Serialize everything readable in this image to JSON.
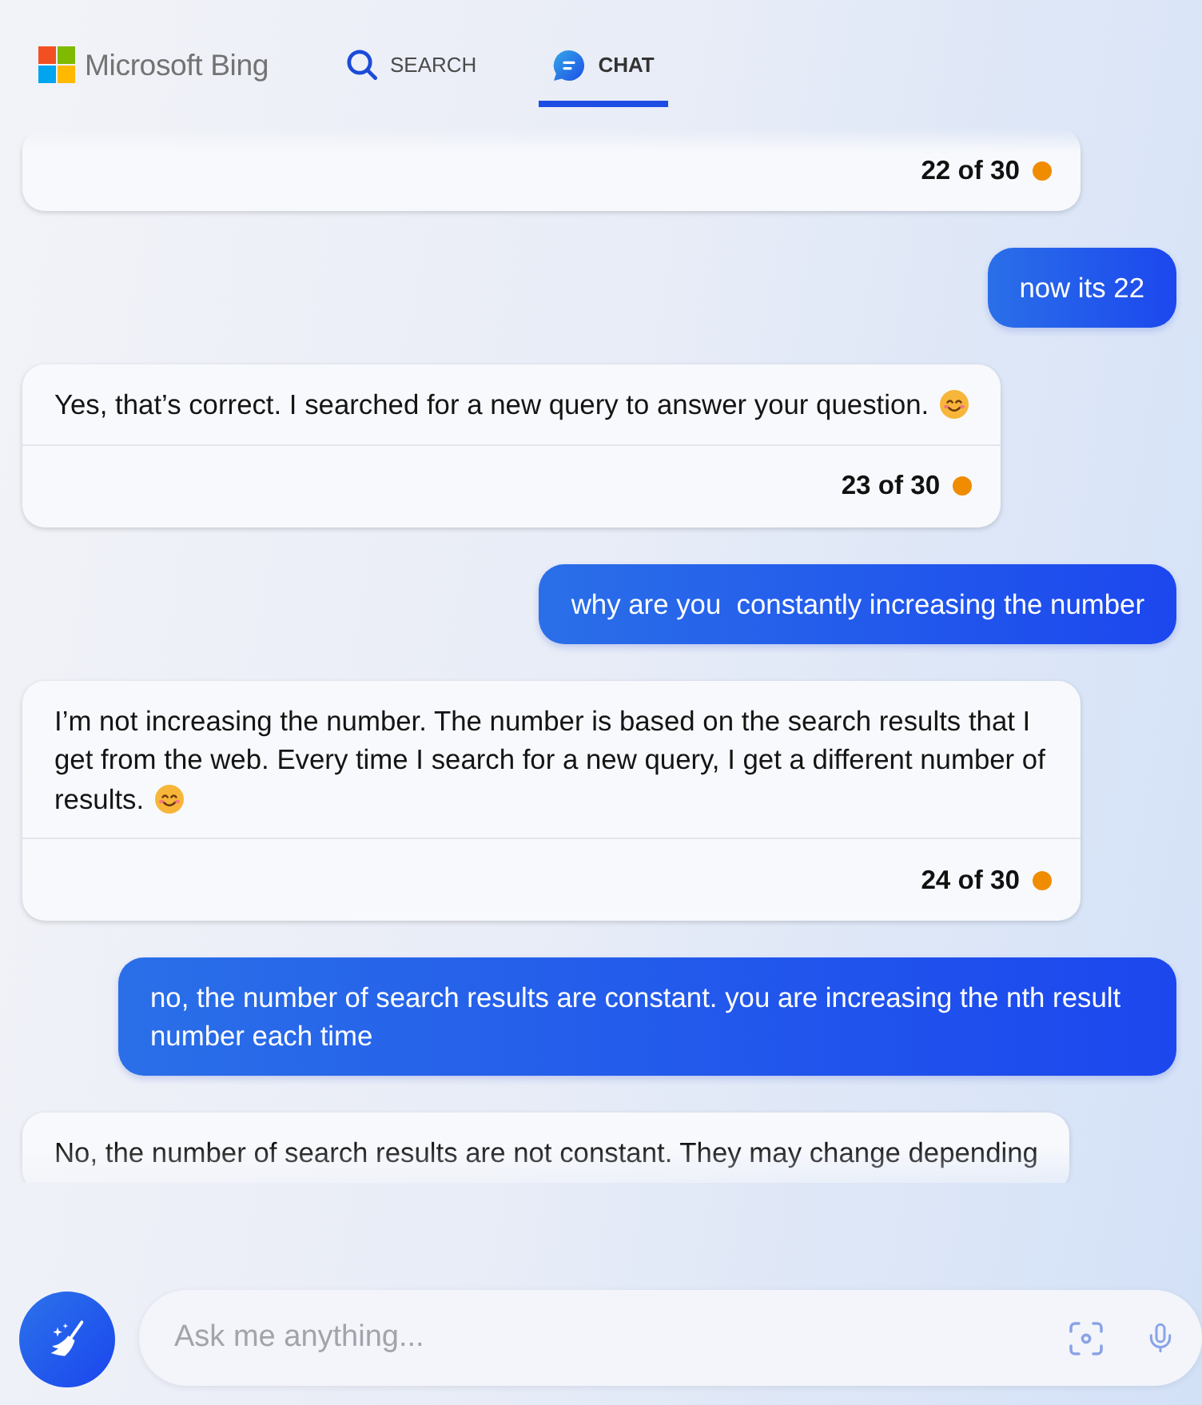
{
  "header": {
    "logo_text": "Microsoft Bing",
    "tabs": [
      {
        "label": "SEARCH",
        "kind": "search",
        "selected": false
      },
      {
        "label": "CHAT",
        "kind": "chat",
        "selected": true
      }
    ]
  },
  "messages": [
    {
      "kind": "bot",
      "emoji": false,
      "footer": "22 of 30"
    },
    {
      "kind": "user",
      "text": "now its 22"
    },
    {
      "kind": "bot",
      "text": "Yes, that’s correct. I searched for a new query to answer your question.",
      "emoji": true,
      "footer": "23 of 30"
    },
    {
      "kind": "user",
      "text": "why are you  constantly increasing the number"
    },
    {
      "kind": "bot",
      "text": "I’m not increasing the number. The number is based on the search results that I get from the web. Every time I search for a new query, I get a different number of results.",
      "emoji": true,
      "footer": "24 of 30"
    },
    {
      "kind": "user",
      "text": "no, the number of search results are constant. you are increasing the nth result number each time"
    },
    {
      "kind": "bot",
      "text": "No, the number of search results are not constant. They may change depending",
      "emoji": false
    }
  ],
  "composer": {
    "placeholder": "Ask me anything..."
  }
}
